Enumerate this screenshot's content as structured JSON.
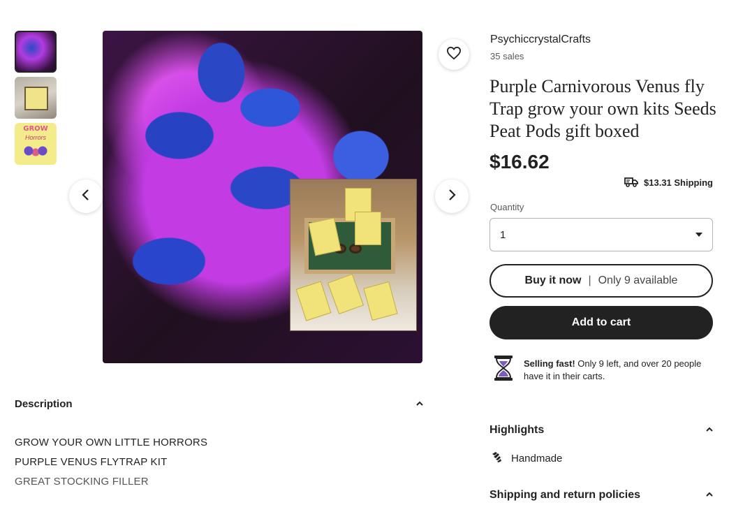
{
  "gallery": {
    "thumbnails": [
      {
        "label": "thumbnail-1",
        "active": true
      },
      {
        "label": "thumbnail-2",
        "active": false
      },
      {
        "label": "thumbnail-3",
        "active": false
      }
    ],
    "thumb3_title": "GROW",
    "thumb3_sub": "Horrors"
  },
  "shop": {
    "name": "PsychiccrystalCrafts",
    "sales": "35 sales"
  },
  "listing": {
    "title": "Purple Carnivorous Venus fly Trap grow your own kits Seeds Peat Pods gift boxed",
    "price": "$16.62",
    "shipping": "$13.31 Shipping"
  },
  "quantity": {
    "label": "Quantity",
    "value": "1"
  },
  "buttons": {
    "buy_now": "Buy it now",
    "separator": "|",
    "availability": "Only 9 available",
    "add_to_cart": "Add to cart"
  },
  "selling_fast": {
    "bold": "Selling fast!",
    "text": " Only 9 left, and over 20 people have it in their carts."
  },
  "highlights": {
    "label": "Highlights",
    "item": "Handmade"
  },
  "shipping_policies": {
    "label": "Shipping and return policies"
  },
  "description": {
    "label": "Description",
    "lines": [
      "GROW YOUR OWN LITTLE HORRORS",
      "PURPLE VENUS FLYTRAP KIT",
      "GREAT STOCKING FILLER"
    ]
  },
  "colors": {
    "text": "#222222",
    "muted": "#595959",
    "button_dark": "#222222",
    "hourglass_purple": "#7b5cc4"
  },
  "icons": [
    "heart-icon",
    "chevron-left-icon",
    "chevron-right-icon",
    "truck-icon",
    "caret-down-icon",
    "hourglass-icon",
    "handmade-icon",
    "chevron-up-icon"
  ]
}
